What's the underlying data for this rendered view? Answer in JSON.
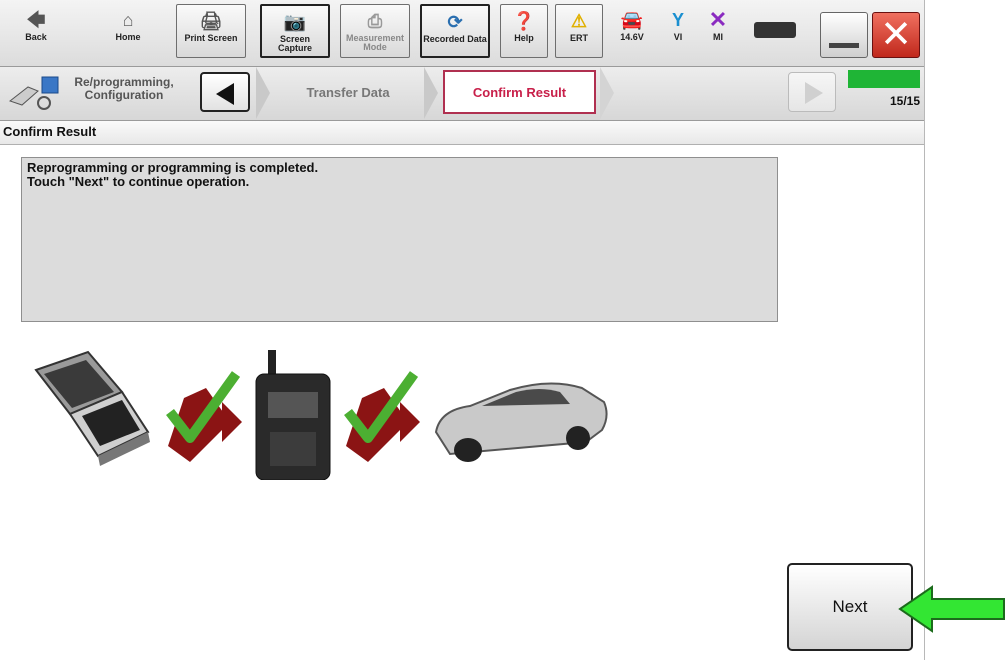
{
  "toolbar": {
    "back": "Back",
    "home": "Home",
    "print_screen": "Print Screen",
    "screen_capture": "Screen Capture",
    "measurement_mode": "Measurement Mode",
    "recorded_data": "Recorded Data",
    "help": "Help",
    "ert": "ERT",
    "voltage": "14.6V",
    "vi": "VI",
    "mi": "MI"
  },
  "nav": {
    "section": "Re/programming, Configuration",
    "step_prev": "Transfer Data",
    "step_current": "Confirm Result",
    "progress_text": "15/15",
    "progress_fraction": 1.0
  },
  "page": {
    "title": "Confirm Result",
    "message_line1": "Reprogramming or programming is completed.",
    "message_line2": "Touch \"Next\" to continue operation.",
    "next_label": "Next"
  },
  "colors": {
    "accent_step": "#c8204a",
    "progress": "#1fb536",
    "arrow": "#33e633",
    "check": "#4caf32",
    "transfer_arrow": "#8b1414"
  }
}
